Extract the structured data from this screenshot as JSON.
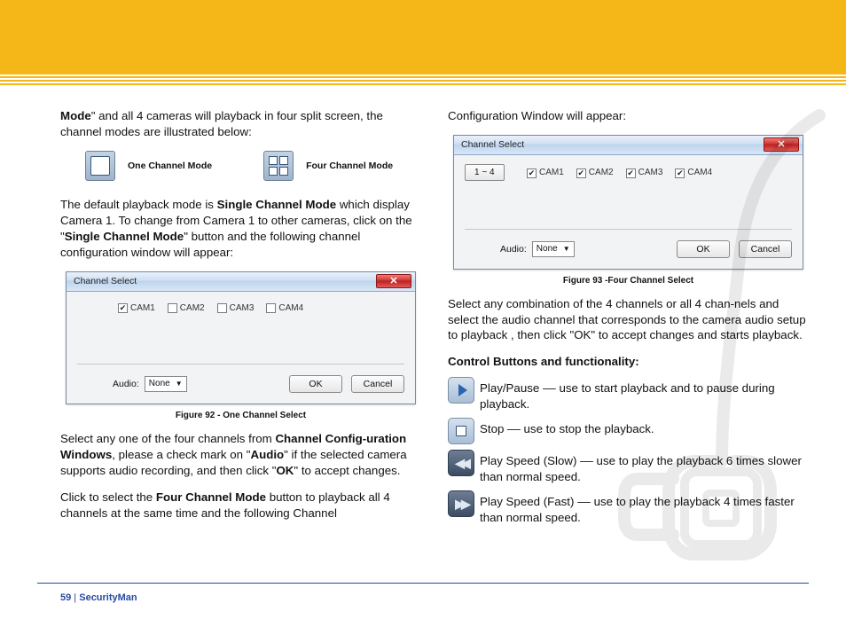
{
  "page": {
    "number": "59",
    "brand": "SecurityMan",
    "separator": "  |  "
  },
  "left": {
    "p1a": "Mode",
    "p1b": "\" and all 4 cameras will playback in four split screen, the channel modes are illustrated below:",
    "mode_one_label": "One Channel Mode",
    "mode_four_label": "Four Channel Mode",
    "p2a": "The default playback mode is ",
    "p2b": "Single Channel Mode",
    "p2c": " which display Camera 1.  To change from Camera 1 to other cameras, click on the \"",
    "p2d": "Single Channel Mode",
    "p2e": "\" button and the following channel configuration window will appear:",
    "fig92_caption": "Figure 92 - One Channel Select",
    "p3a": "Select any one of the four channels from ",
    "p3b": "Channel Config-uration Windows",
    "p3c": ", please a check mark on \"",
    "p3d": "Audio",
    "p3e": "\" if the selected camera supports audio recording, and then click \"",
    "p3f": "OK",
    "p3g": "\" to accept changes.",
    "p4a": "Click to select the ",
    "p4b": "Four Channel Mode",
    "p4c": " button to playback all 4 channels at the same time and the following Channel"
  },
  "right": {
    "p1": "Configuration Window will appear:",
    "fig93_caption": "Figure 93 -Four Channel Select",
    "p2": "Select any combination of the 4 channels or all 4 chan-nels and select the audio channel that corresponds to the camera audio setup to playback , then click \"OK\" to accept changes and starts playback.",
    "p3": "Control Buttons and functionality:",
    "play_text": " Play/Pause –– use to start playback and to pause during playback.",
    "stop_text": " Stop –– use to stop the playback.",
    "slow_text": " Play Speed (Slow) –– use to play the playback 6 times slower than normal speed.",
    "fast_text": " Play Speed (Fast) –– use to play the playback 4 times faster than normal speed."
  },
  "dialog": {
    "title": "Channel Select",
    "range_btn": "1 ~ 4",
    "cams": [
      "CAM1",
      "CAM2",
      "CAM3",
      "CAM4"
    ],
    "audio_label": "Audio:",
    "audio_value": "None",
    "ok": "OK",
    "cancel": "Cancel"
  }
}
